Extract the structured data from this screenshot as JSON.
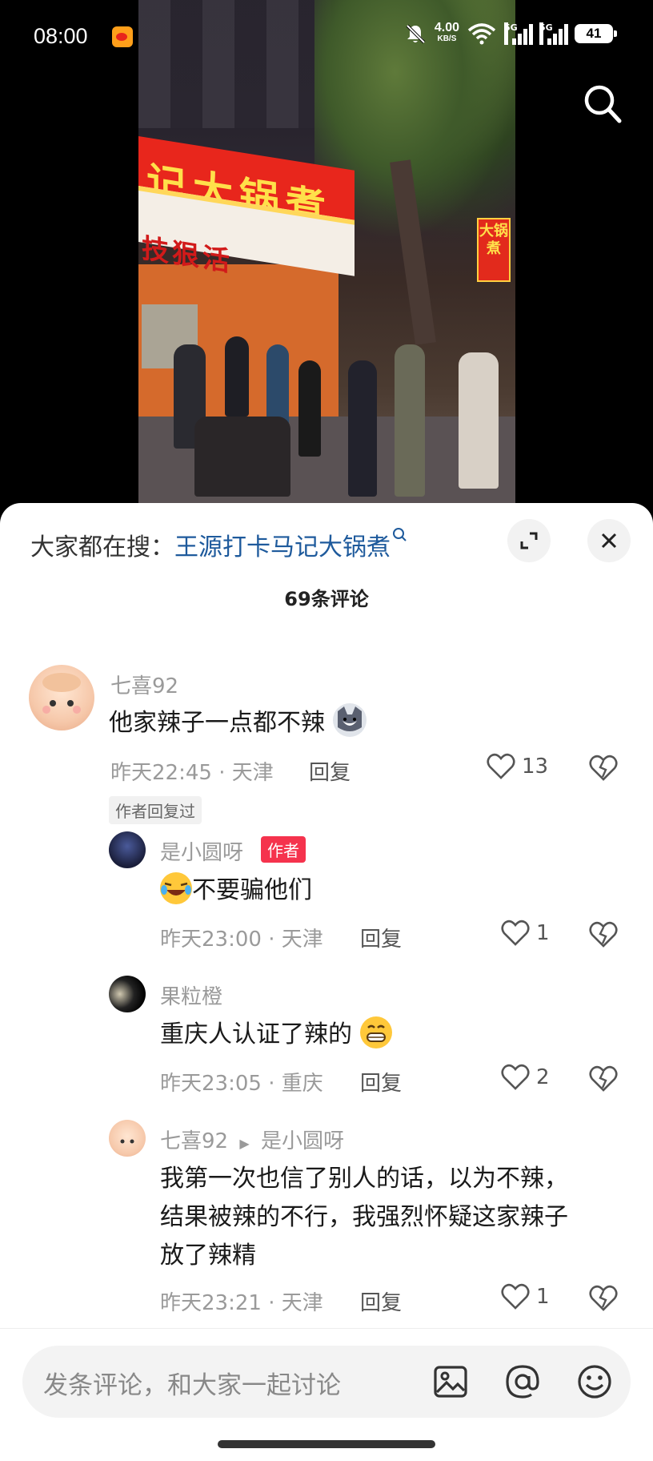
{
  "status_bar": {
    "time": "08:00",
    "net_speed": "4.00",
    "net_unit": "KB/S",
    "signal_label": "5G",
    "battery": "41"
  },
  "icons": {
    "search": "search-icon",
    "expand": "expand-icon",
    "close": "close-icon",
    "image": "image-icon",
    "at": "at-icon",
    "emoji": "emoji-icon",
    "like": "heart-icon",
    "dislike": "broken-heart-icon"
  },
  "video": {
    "sign_main": "记大锅煮",
    "sign_sub": "技狠活",
    "side_sign": "大锅煮"
  },
  "sheet": {
    "hot_search_prefix": "大家都在搜：",
    "hot_search_link": "王源打卡马记大锅煮",
    "comment_count": "69条评论"
  },
  "comments": [
    {
      "username": "七喜92",
      "text": "他家辣子一点都不辣",
      "time_location": "昨天22:45 · 天津",
      "reply": "回复",
      "likes": "13",
      "tag": "作者回复过"
    },
    {
      "username": "是小圆呀",
      "badge": "作者",
      "text": "不要骗他们",
      "time_location": "昨天23:00 · 天津",
      "reply": "回复",
      "likes": "1"
    },
    {
      "username": "果粒橙",
      "text": "重庆人认证了辣的",
      "time_location": "昨天23:05 · 重庆",
      "reply": "回复",
      "likes": "2"
    },
    {
      "username": "七喜92",
      "reply_to": "是小圆呀",
      "text_line1": "我第一次也信了别人的话，以为不辣，",
      "text_line2": "结果被辣的不行，我强烈怀疑这家辣子",
      "text_line3": "放了辣精",
      "time_location": "昨天23:21 · 天津",
      "reply": "回复",
      "likes": "1"
    }
  ],
  "input": {
    "placeholder": "发条评论，和大家一起讨论"
  }
}
